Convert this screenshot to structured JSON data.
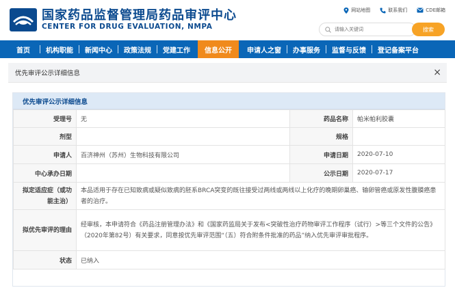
{
  "header": {
    "title_cn": "国家药品监督管理局药品审评中心",
    "title_en": "CENTER FOR DRUG EVALUATION, NMPA",
    "links": {
      "sitemap": "网站地图",
      "contact": "联系我们",
      "email": "CDE邮箱"
    },
    "search_placeholder": "请输入关键词",
    "search_button": "搜索"
  },
  "nav": {
    "items": [
      "首页",
      "机构职能",
      "新闻中心",
      "政策法规",
      "党建工作",
      "信息公开",
      "申请人之窗",
      "办事服务",
      "监督与反馈",
      "登记备案平台"
    ],
    "active_index": 5
  },
  "subbar": {
    "title": "优先审评公示详细信息",
    "close": "×"
  },
  "panel": {
    "heading": "优先审评公示详细信息",
    "rows": {
      "accept_no_label": "受理号",
      "accept_no_value": "无",
      "drug_name_label": "药品名称",
      "drug_name_value": "帕米帕利胶囊",
      "dosage_label": "剂型",
      "dosage_value": "",
      "spec_label": "规格",
      "spec_value": "",
      "applicant_label": "申请人",
      "applicant_value": "百济神州（苏州）生物科技有限公司",
      "apply_date_label": "申请日期",
      "apply_date_value": "2020-07-10",
      "dept_date_label": "中心承办日期",
      "dept_date_value": "",
      "publish_date_label": "公示日期",
      "publish_date_value": "2020-07-17",
      "indication_label": "拟定适应症（或功能主治）",
      "indication_value": "本品适用于存在已知致病或疑似致病的胚系BRCA突变的既往接受过两线或两线以上化疗的晚期卵巢癌、输卵管癌或原发性腹膜癌患者的治疗。",
      "reason_label": "拟优先审评的理由",
      "reason_value": "经审核，本申请符合《药品注册管理办法》和《国家药监局关于发布<突破性治疗药物审评工作程序（试行）>等三个文件的公告》（2020年第82号）有关要求，同意按优先审评范围“（五）符合附条件批准的药品”纳入优先审评审批程序。",
      "status_label": "状态",
      "status_value": "已纳入"
    }
  },
  "colors": {
    "brand_blue": "#0b4a8f",
    "nav_blue": "#0a66b7",
    "active_orange": "#f08a1c",
    "search_orange": "#f7a326"
  }
}
